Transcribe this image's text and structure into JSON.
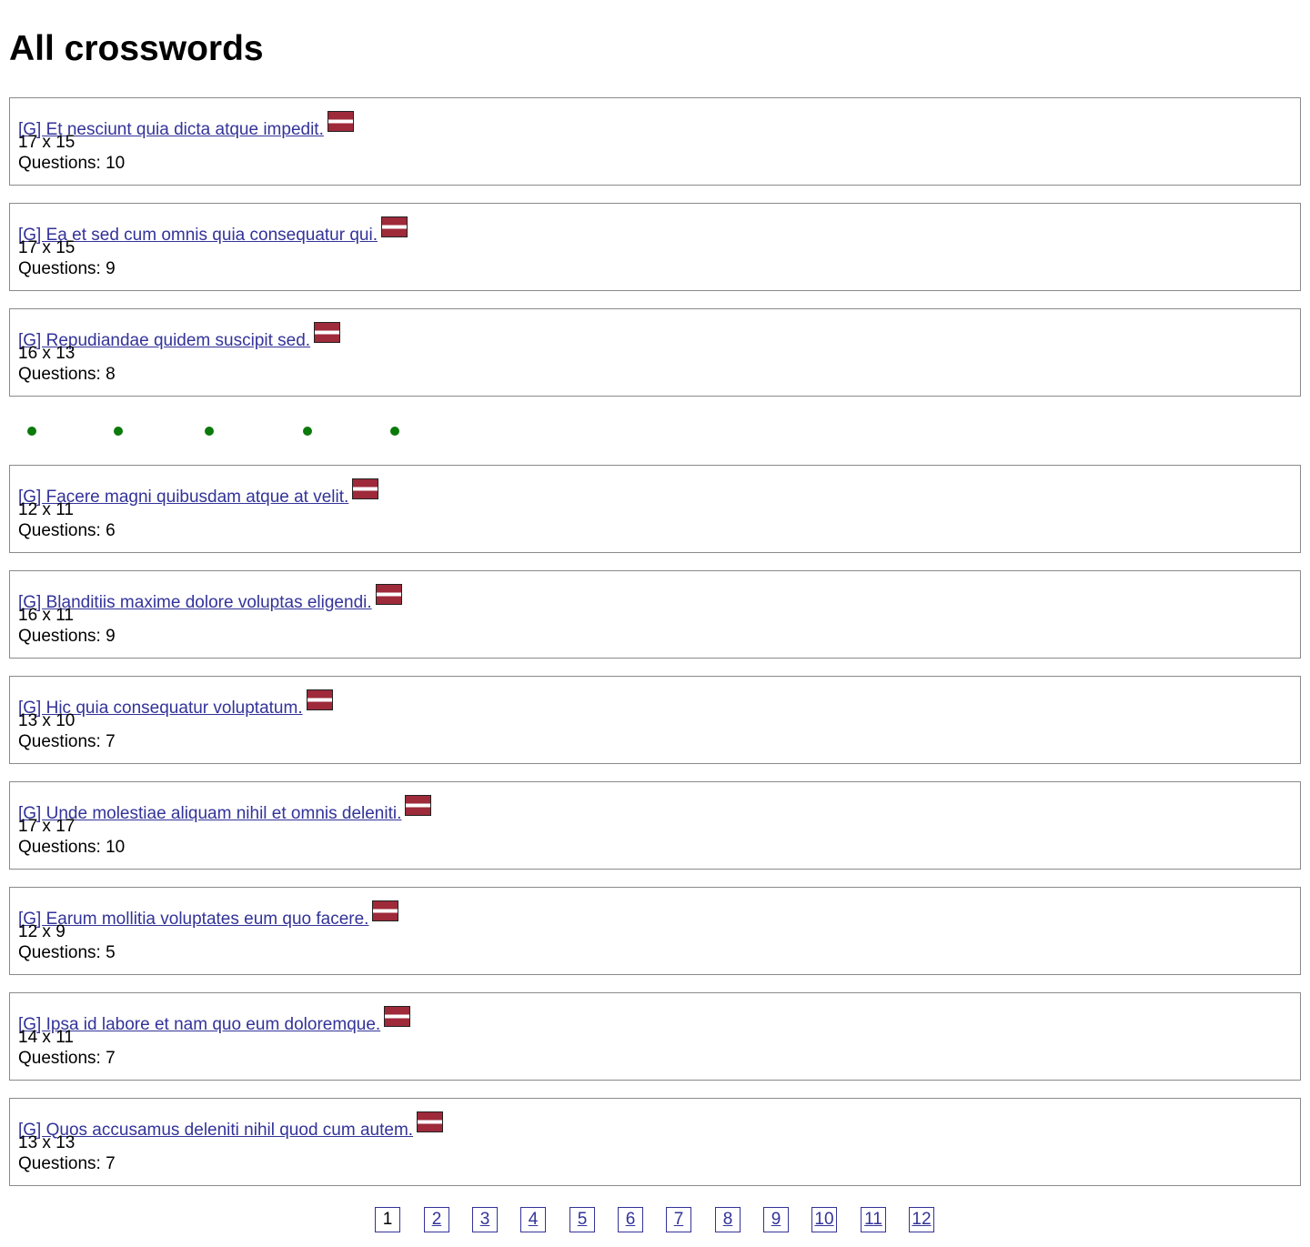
{
  "page": {
    "title": "All crosswords"
  },
  "crosswords": [
    {
      "title": "[G] Et nesciunt quia dicta atque impedit.",
      "size": "17 x 15",
      "questions": "Questions: 10",
      "flag_icon": "latvia-flag-icon"
    },
    {
      "title": "[G] Ea et sed cum omnis quia consequatur qui.",
      "size": "17 x 15",
      "questions": "Questions: 9",
      "flag_icon": "latvia-flag-icon"
    },
    {
      "title": "[G] Repudiandae quidem suscipit sed.",
      "size": "16 x 13",
      "questions": "Questions: 8",
      "flag_icon": "latvia-flag-icon"
    },
    {
      "title": "[G] Facere magni quibusdam atque at velit.",
      "size": "12 x 11",
      "questions": "Questions: 6",
      "flag_icon": "latvia-flag-icon"
    },
    {
      "title": "[G] Blanditiis maxime dolore voluptas eligendi.",
      "size": "16 x 11",
      "questions": "Questions: 9",
      "flag_icon": "latvia-flag-icon"
    },
    {
      "title": "[G] Hic quia consequatur voluptatum.",
      "size": "13 x 10",
      "questions": "Questions: 7",
      "flag_icon": "latvia-flag-icon"
    },
    {
      "title": "[G] Unde molestiae aliquam nihil et omnis deleniti.",
      "size": "17 x 17",
      "questions": "Questions: 10",
      "flag_icon": "latvia-flag-icon"
    },
    {
      "title": "[G] Earum mollitia voluptates eum quo facere.",
      "size": "12 x 9",
      "questions": "Questions: 5",
      "flag_icon": "latvia-flag-icon"
    },
    {
      "title": "[G] Ipsa id labore et nam quo eum doloremque.",
      "size": "14 x 11",
      "questions": "Questions: 7",
      "flag_icon": "latvia-flag-icon"
    },
    {
      "title": "[G] Quos accusamus deleniti nihil quod cum autem.",
      "size": "13 x 13",
      "questions": "Questions: 7",
      "flag_icon": "latvia-flag-icon"
    }
  ],
  "colors": {
    "link": "#333399",
    "card_border": "#8a8a8a",
    "dot": "#0a7a0a",
    "flag_red": "#9e2a3a"
  },
  "pagination": {
    "pages": [
      "1",
      "2",
      "3",
      "4",
      "5",
      "6",
      "7",
      "8",
      "9",
      "10",
      "11",
      "12"
    ],
    "current": "1"
  }
}
